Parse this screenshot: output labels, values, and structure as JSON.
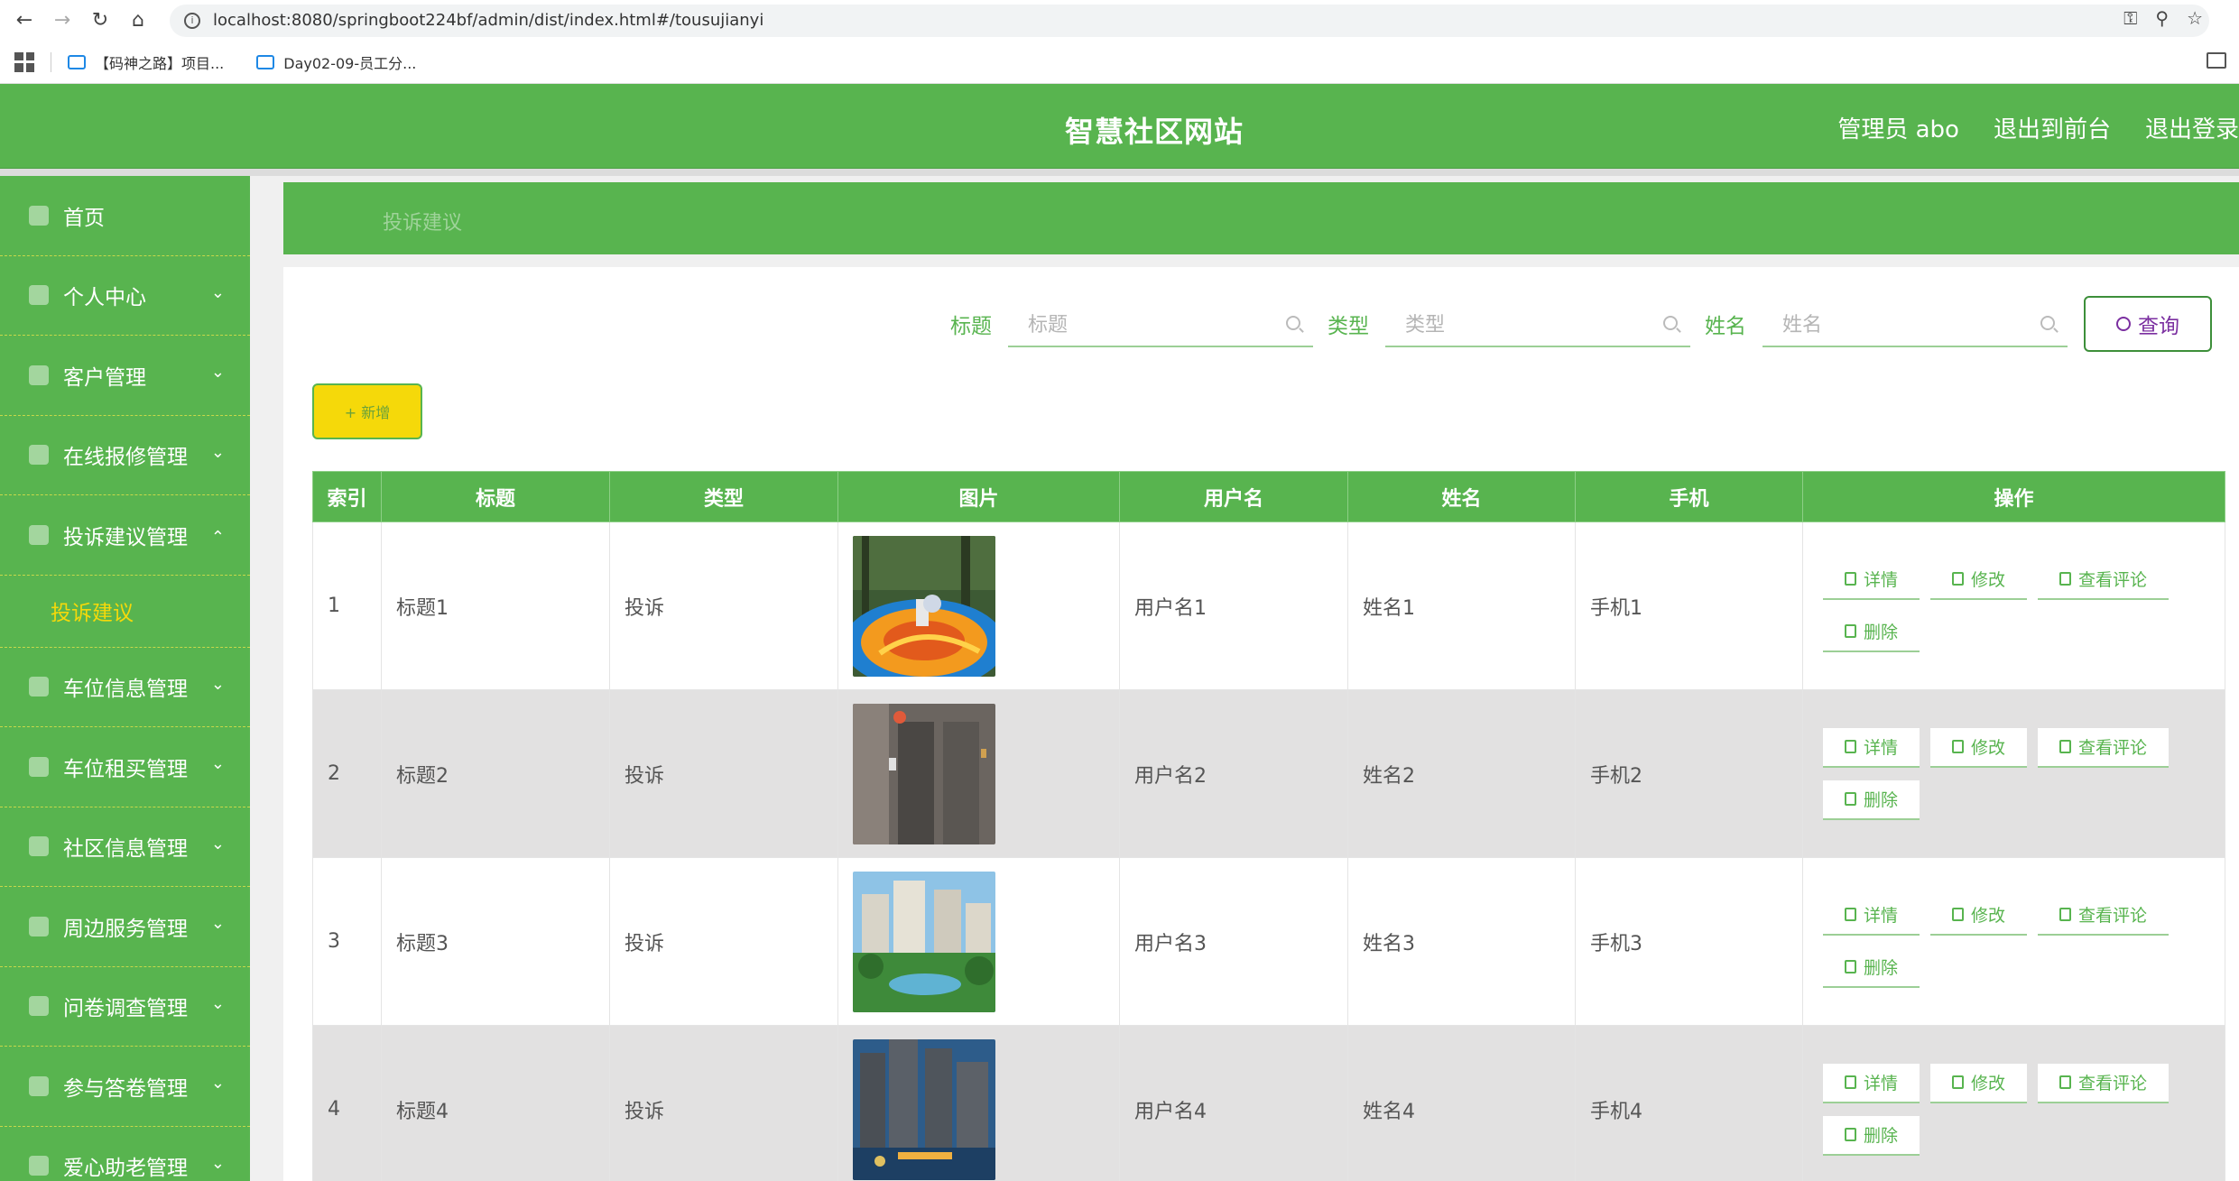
{
  "browser": {
    "url": "localhost:8080/springboot224bf/admin/dist/index.html#/tousujianyi",
    "bookmarks": [
      "【码神之路】项目...",
      "Day02-09-员工分..."
    ]
  },
  "header": {
    "title": "智慧社区网站",
    "user": "管理员 abo",
    "front_link": "退出到前台",
    "logout_link": "退出登录"
  },
  "sidebar": {
    "items": [
      {
        "label": "首页",
        "expandable": false
      },
      {
        "label": "个人中心",
        "expandable": true
      },
      {
        "label": "客户管理",
        "expandable": true
      },
      {
        "label": "在线报修管理",
        "expandable": true
      },
      {
        "label": "投诉建议管理",
        "expandable": true,
        "expanded": true
      },
      {
        "label": "车位信息管理",
        "expandable": true
      },
      {
        "label": "车位租买管理",
        "expandable": true
      },
      {
        "label": "社区信息管理",
        "expandable": true
      },
      {
        "label": "周边服务管理",
        "expandable": true
      },
      {
        "label": "问卷调查管理",
        "expandable": true
      },
      {
        "label": "参与答卷管理",
        "expandable": true
      },
      {
        "label": "爱心助老管理",
        "expandable": true
      }
    ],
    "active_sub": "投诉建议"
  },
  "breadcrumb": "投诉建议",
  "search": {
    "title_label": "标题",
    "title_placeholder": "标题",
    "type_label": "类型",
    "type_placeholder": "类型",
    "name_label": "姓名",
    "name_placeholder": "姓名",
    "query_label": "查询"
  },
  "add_label": "+ 新增",
  "table": {
    "headers": [
      "索引",
      "标题",
      "类型",
      "图片",
      "用户名",
      "姓名",
      "手机",
      "操作"
    ],
    "rows": [
      {
        "index": "1",
        "title": "标题1",
        "type": "投诉",
        "image": "playground",
        "username": "用户名1",
        "name": "姓名1",
        "phone": "手机1"
      },
      {
        "index": "2",
        "title": "标题2",
        "type": "投诉",
        "image": "elevator",
        "username": "用户名2",
        "name": "姓名2",
        "phone": "手机2"
      },
      {
        "index": "3",
        "title": "标题3",
        "type": "投诉",
        "image": "residential-garden",
        "username": "用户名3",
        "name": "姓名3",
        "phone": "手机3"
      },
      {
        "index": "4",
        "title": "标题4",
        "type": "投诉",
        "image": "buildings-night",
        "username": "用户名4",
        "name": "姓名4",
        "phone": "手机4"
      }
    ],
    "actions": {
      "detail": "详情",
      "edit": "修改",
      "comments": "查看评论",
      "delete": "删除"
    }
  },
  "colors": {
    "primary": "#58b44f",
    "accent": "#f5d90a",
    "query": "#7b2fa0"
  }
}
